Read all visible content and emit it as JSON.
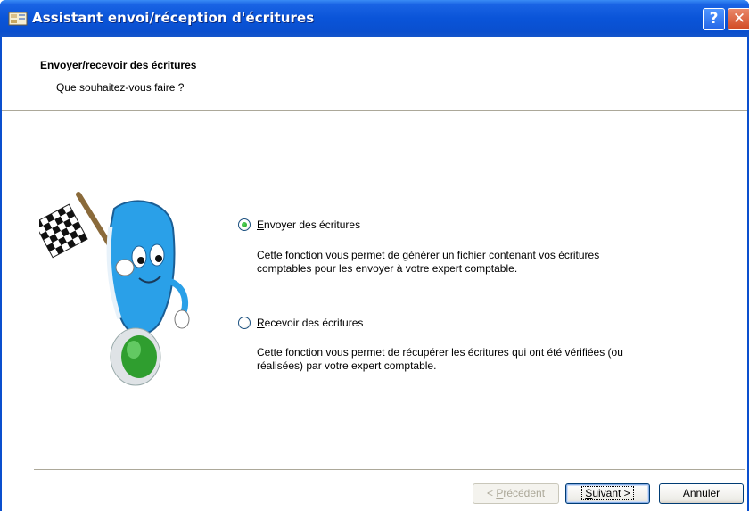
{
  "window": {
    "title": "Assistant envoi/réception d'écritures",
    "app_icon": "wizard-app-icon",
    "help_label": "?",
    "close_label": "✕"
  },
  "header": {
    "title": "Envoyer/recevoir des écritures",
    "subtitle": "Que souhaitez-vous faire ?"
  },
  "options": [
    {
      "accesskey": "E",
      "label_rest": "nvoyer des écritures",
      "selected": true,
      "description_line1": "Cette fonction vous permet de générer un fichier contenant vos écritures",
      "description_line2": "comptables pour les envoyer à votre expert comptable."
    },
    {
      "accesskey": "R",
      "label_rest": "ecevoir des écritures",
      "selected": false,
      "description_line1": "Cette fonction vous permet de récupérer les écritures qui ont été vérifiées (ou",
      "description_line2": "réalisées) par votre expert comptable."
    }
  ],
  "buttons": {
    "previous": {
      "prefix": "< ",
      "accesskey": "P",
      "rest": "récédent",
      "enabled": false
    },
    "next": {
      "accesskey": "S",
      "rest": "uivant >",
      "enabled": true
    },
    "cancel": {
      "label": "Annuler",
      "enabled": true
    }
  },
  "colors": {
    "titlebar": "#0a54d8",
    "radio_dot": "#21a121",
    "mascot_body": "#2aa0e8",
    "mascot_button": "#2f9e2f"
  }
}
